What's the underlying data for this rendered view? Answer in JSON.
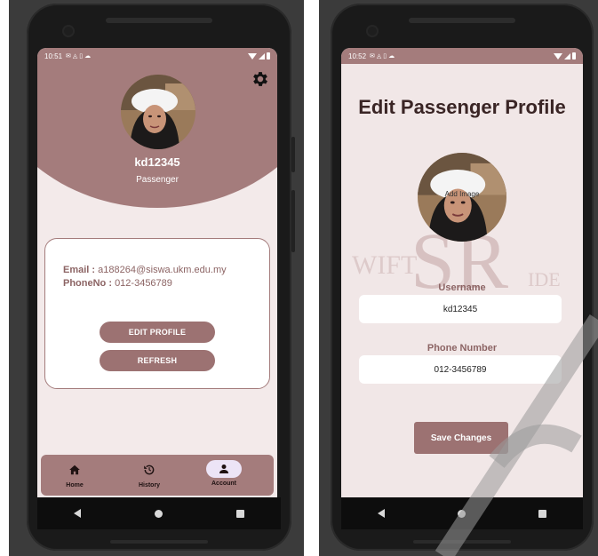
{
  "left_screen": {
    "status_time": "10:51",
    "username": "kd12345",
    "role": "Passenger",
    "email_label": "Email :",
    "email_value": "a188264@siswa.ukm.edu.my",
    "phone_label": "PhoneNo :",
    "phone_value": "012-3456789",
    "edit_profile_button": "EDIT PROFILE",
    "refresh_button": "REFRESH",
    "nav": [
      {
        "label": "Home",
        "icon": "home-icon"
      },
      {
        "label": "History",
        "icon": "history-icon"
      },
      {
        "label": "Account",
        "icon": "account-icon",
        "active": true
      }
    ]
  },
  "right_screen": {
    "status_time": "10:52",
    "title": "Edit Passenger Profile",
    "add_image_hint": "Add Image",
    "username_label": "Username",
    "username_value": "kd12345",
    "phone_label": "Phone Number",
    "phone_value": "012-3456789",
    "save_button": "Save Changes"
  },
  "colors": {
    "accent": "#a47c7c",
    "button": "#9c7272",
    "text_accent": "#8c6464",
    "active_nav": "#ece4f6"
  }
}
